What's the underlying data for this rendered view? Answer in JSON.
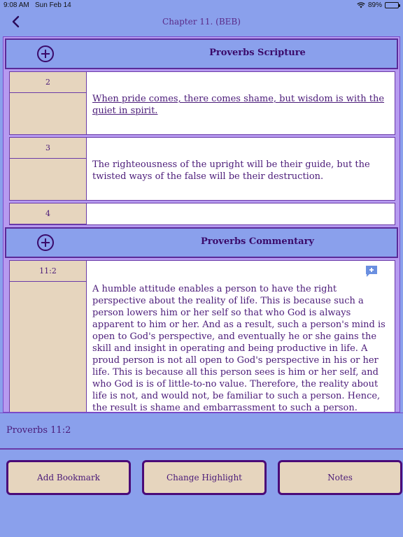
{
  "status": {
    "time": "9:08 AM",
    "date": "Sun Feb 14",
    "battery": "89%"
  },
  "nav": {
    "title": "Chapter 11. (BEB)"
  },
  "scripture": {
    "title": "Proverbs Scripture",
    "rows": [
      {
        "number": "2",
        "text": "When pride comes, there comes shame, but wisdom is with the quiet in spirit."
      },
      {
        "number": "3",
        "text": "The righteousness of the upright will be their guide, but the twisted ways of the false will be their destruction."
      },
      {
        "number": "4",
        "text": ""
      }
    ]
  },
  "commentary": {
    "title": "Proverbs Commentary",
    "reference": "11:2",
    "text": "A humble attitude enables a person to have the right perspective about the reality of life. This is because such a person lowers him or her self so that who God is always apparent to him or her. And as a result, such a person's mind is open to God's perspective, and eventually he or she gains the skill and insight in operating and being productive in life. A proud person is not all open to God's perspective in his or her life. This is because all this person sees is him or her self, and who God is is of little-to-no value. Therefore, the reality about life is not, and would not, be familiar to such a person. Hence, the result is shame and embarrassment to such a person."
  },
  "footer": {
    "reference": "Proverbs 11:2",
    "buttons": {
      "bookmark": "Add Bookmark",
      "highlight": "Change Highlight",
      "notes": "Notes"
    }
  },
  "colors": {
    "background": "#8aa0ec",
    "text": "#4a1a78",
    "numberCell": "#e6d5be",
    "border": "#5a2a98"
  }
}
